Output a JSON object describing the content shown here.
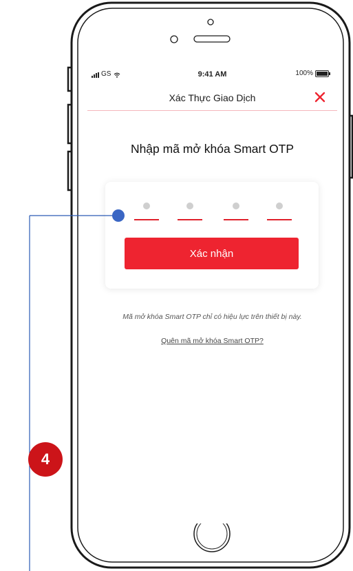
{
  "status_bar": {
    "carrier": "GS",
    "time": "9:41 AM",
    "battery": "100%"
  },
  "nav": {
    "title": "Xác Thực Giao Dịch",
    "close_icon": "close-icon"
  },
  "heading": "Nhập mã mở khóa Smart OTP",
  "otp": {
    "digits_total": 4,
    "digits_entered": 0
  },
  "confirm_label": "Xác nhận",
  "info_text": "Mã mở khóa Smart OTP chỉ có hiệu lực trên thiết bị này.",
  "forgot_link": "Quên mã mở khóa Smart OTP?",
  "annotation": {
    "badge_number": "4"
  },
  "colors": {
    "accent": "#ee2430",
    "annotation_badge": "#cc1419",
    "annotation_line": "#2a5ab5",
    "phone_outline": "#1a1a1a"
  }
}
